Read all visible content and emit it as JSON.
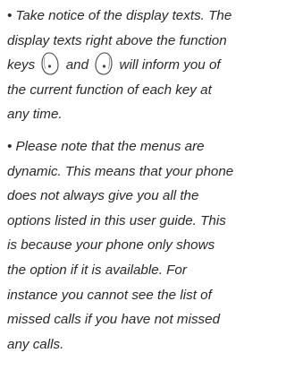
{
  "paragraph_1": {
    "line_1": "• Take notice of the display texts. The",
    "line_2": "display texts right above the function",
    "line_3_start": "keys",
    "line_3_middle": "and",
    "line_3_end": "will inform you of",
    "line_4": "the current function of each key at",
    "line_5": "any time.",
    "icons": [
      "left-function-key-icon",
      "right-function-key-icon"
    ]
  },
  "paragraph_2": {
    "lines": [
      "• Please note that the menus are",
      "dynamic. This means that your phone",
      "does not always give you all the",
      "options listed in this user guide. This",
      "is because your phone only shows",
      "the option if it is available. For",
      "instance you cannot see the list of",
      "missed calls if you have not missed",
      "any calls."
    ]
  }
}
